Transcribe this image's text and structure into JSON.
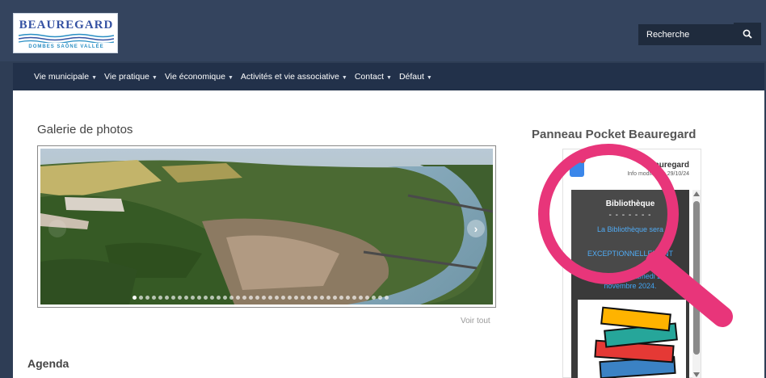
{
  "logo": {
    "title": "BEAUREGARD",
    "subtitle": "DOMBES SAÔNE VALLÉE"
  },
  "search": {
    "placeholder": "Recherche",
    "icon": "search-icon"
  },
  "nav": {
    "items": [
      {
        "label": "Vie municipale"
      },
      {
        "label": "Vie pratique"
      },
      {
        "label": "Vie économique"
      },
      {
        "label": "Activités et vie associative"
      },
      {
        "label": "Contact"
      },
      {
        "label": "Défaut"
      }
    ]
  },
  "gallery": {
    "title": "Galerie de photos",
    "view_all": "Voir tout",
    "dot_count": 40,
    "active_dot": 0
  },
  "agenda": {
    "title": "Agenda"
  },
  "pocket": {
    "title": "Panneau Pocket Beauregard",
    "name": "Beauregard",
    "info": "Info modifiée le 29/10/24",
    "notice": {
      "title": "Bibliothèque",
      "separator": "- - - - - - -",
      "line1": "La Bibliothèque sera",
      "line2": "EXCEPTIONNELLEMENT",
      "line3": "fermée le samedi 2",
      "line4": "novembre 2024."
    }
  },
  "colors": {
    "header": "#34445e",
    "nav": "#22314a",
    "accent": "#e8357a",
    "notice_text": "#42a5f5"
  }
}
